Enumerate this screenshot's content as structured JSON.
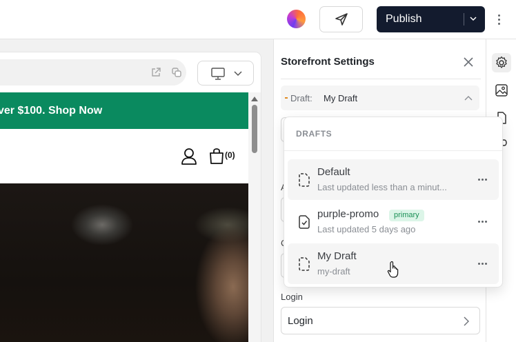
{
  "toolbar": {
    "publish_label": "Publish"
  },
  "preview": {
    "banner_text": "ver $100. Shop Now",
    "cart_count": "(0)"
  },
  "panel": {
    "title": "Storefront Settings",
    "draft_prefix": "Draft:",
    "draft_value": "My Draft",
    "hidden_label_1": "A",
    "hidden_label_2": "C",
    "login_label": "Login",
    "login_value": "Login"
  },
  "drafts": {
    "header": "DRAFTS",
    "items": [
      {
        "name": "Default",
        "subtitle": "Last updated less than a minut...",
        "badge": ""
      },
      {
        "name": "purple-promo",
        "subtitle": "Last updated 5 days ago",
        "badge": "primary"
      },
      {
        "name": "My Draft",
        "subtitle": "my-draft",
        "badge": ""
      }
    ]
  },
  "colors": {
    "publish_bg": "#131b2e",
    "banner_bg": "#0a8a5f",
    "badge_bg": "#dcf5e8",
    "badge_text": "#1a8f55",
    "draft_dot": "#e08a1e"
  }
}
